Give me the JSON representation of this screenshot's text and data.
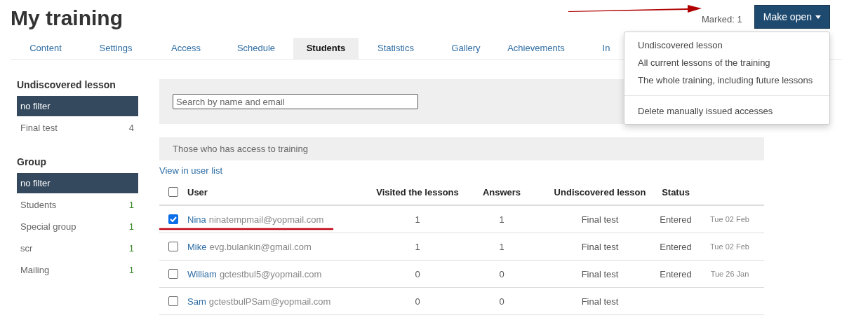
{
  "page_title": "My training",
  "marked": "Marked: 1",
  "action_button": {
    "label": "Make open"
  },
  "dropdown": {
    "items": [
      {
        "label": "Undiscovered lesson",
        "kind": "item"
      },
      {
        "label": "All current lessons of the training",
        "kind": "item"
      },
      {
        "label": "The whole training, including future lessons",
        "kind": "item"
      },
      {
        "kind": "divider"
      },
      {
        "label": "Delete manually issued accesses",
        "kind": "item"
      }
    ]
  },
  "tabs": [
    {
      "label": "Content",
      "selected": false
    },
    {
      "label": "Settings",
      "selected": false
    },
    {
      "label": "Access",
      "selected": false
    },
    {
      "label": "Schedule",
      "selected": false
    },
    {
      "label": "Students",
      "selected": true
    },
    {
      "label": "Statistics",
      "selected": false
    },
    {
      "label": "Gallery",
      "selected": false
    },
    {
      "label": "Achievements",
      "selected": false
    },
    {
      "label": "In",
      "selected": false
    }
  ],
  "sidebar": {
    "sections": [
      {
        "title": "Undiscovered lesson",
        "items": [
          {
            "label": "no filter",
            "selected": true
          },
          {
            "label": "Final test",
            "count": "4",
            "selected": false
          }
        ]
      },
      {
        "title": "Group",
        "items": [
          {
            "label": "no filter",
            "selected": true
          },
          {
            "label": "Students",
            "count": "1",
            "selected": false
          },
          {
            "label": "Special group",
            "count": "1",
            "selected": false
          },
          {
            "label": "scr",
            "count": "1",
            "selected": false
          },
          {
            "label": "Mailing",
            "count": "1",
            "selected": false
          }
        ]
      }
    ]
  },
  "search": {
    "placeholder": "Search by name and email"
  },
  "access_header": "Those who has access to training",
  "view_link": "View in user list",
  "table": {
    "select_all_checked": false,
    "columns": [
      "User",
      "Visited the lessons",
      "Answers",
      "Undiscovered lesson",
      "Status"
    ],
    "rows": [
      {
        "checked": true,
        "highlighted": true,
        "name": "Nina",
        "email": "ninatempmail@yopmail.com",
        "visited": "1",
        "answers": "1",
        "lesson": "Final test",
        "status": "Entered",
        "date": "Tue 02 Feb"
      },
      {
        "checked": false,
        "highlighted": false,
        "name": "Mike",
        "email": "evg.bulankin@gmail.com",
        "visited": "1",
        "answers": "1",
        "lesson": "Final test",
        "status": "Entered",
        "date": "Tue 02 Feb"
      },
      {
        "checked": false,
        "highlighted": false,
        "name": "William",
        "email": "gctestbul5@yopmail.com",
        "visited": "0",
        "answers": "0",
        "lesson": "Final test",
        "status": "Entered",
        "date": "Tue 26 Jan"
      },
      {
        "checked": false,
        "highlighted": false,
        "name": "Sam",
        "email": "gctestbulPSam@yopmail.com",
        "visited": "0",
        "answers": "0",
        "lesson": "Final test"
      }
    ]
  }
}
